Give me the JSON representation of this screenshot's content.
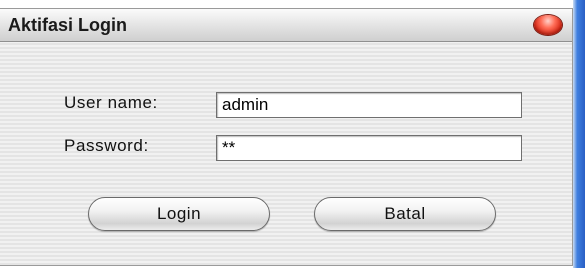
{
  "window": {
    "title": "Aktifasi Login"
  },
  "form": {
    "username_label": "User name:",
    "username_value": "admin",
    "password_label": "Password:",
    "password_value": "**"
  },
  "buttons": {
    "login_label": "Login",
    "cancel_label": "Batal"
  },
  "colors": {
    "close_button": "#e0301c",
    "side_strip": "#3f7fe0"
  }
}
